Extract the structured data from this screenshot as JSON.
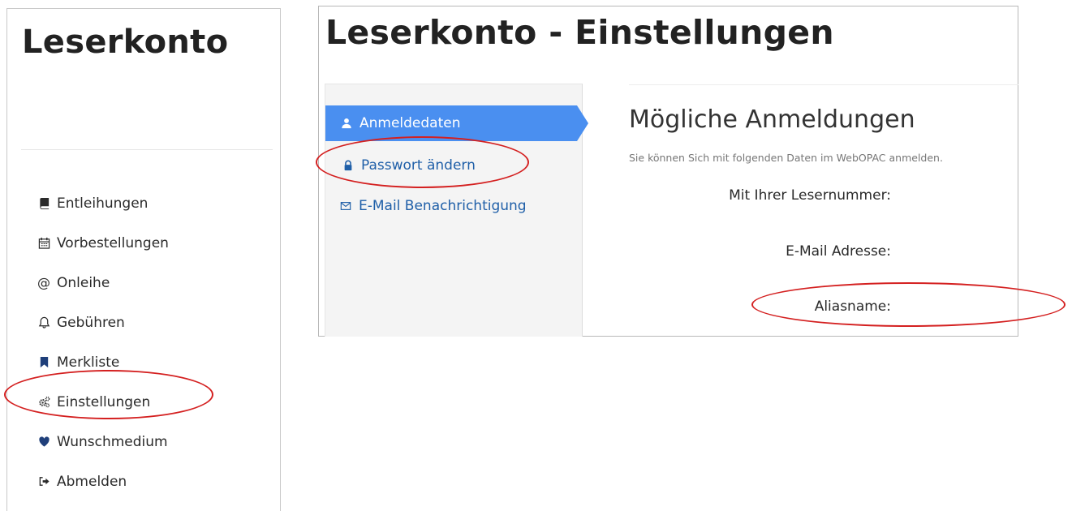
{
  "left_panel": {
    "title": "Leserkonto",
    "nav": [
      {
        "label": "Entleihungen",
        "icon": "book-icon"
      },
      {
        "label": "Vorbestellungen",
        "icon": "calendar-icon"
      },
      {
        "label": "Onleihe",
        "icon": "at-icon"
      },
      {
        "label": "Gebühren",
        "icon": "bell-icon"
      },
      {
        "label": "Merkliste",
        "icon": "bookmark-icon"
      },
      {
        "label": "Einstellungen",
        "icon": "gears-icon"
      },
      {
        "label": "Wunschmedium",
        "icon": "heart-icon"
      },
      {
        "label": "Abmelden",
        "icon": "sign-out-icon"
      }
    ]
  },
  "right_panel": {
    "title": "Leserkonto - Einstellungen",
    "settings_nav": [
      {
        "label": "Anmeldedaten",
        "icon": "user-icon",
        "active": true
      },
      {
        "label": "Passwort ändern",
        "icon": "lock-icon",
        "active": false
      },
      {
        "label": "E-Mail Benachrichtigung",
        "icon": "envelope-icon",
        "active": false
      }
    ],
    "content": {
      "title": "Mögliche Anmeldungen",
      "subtitle": "Sie können Sich mit folgenden Daten im WebOPAC anmelden.",
      "fields": [
        "Mit Ihrer Lesernummer:",
        "E-Mail Adresse:",
        "Aliasname:"
      ]
    }
  },
  "colors": {
    "accent_blue": "#4a8ff0",
    "link_blue": "#1f5fa8",
    "annotation_red": "#d42020"
  }
}
